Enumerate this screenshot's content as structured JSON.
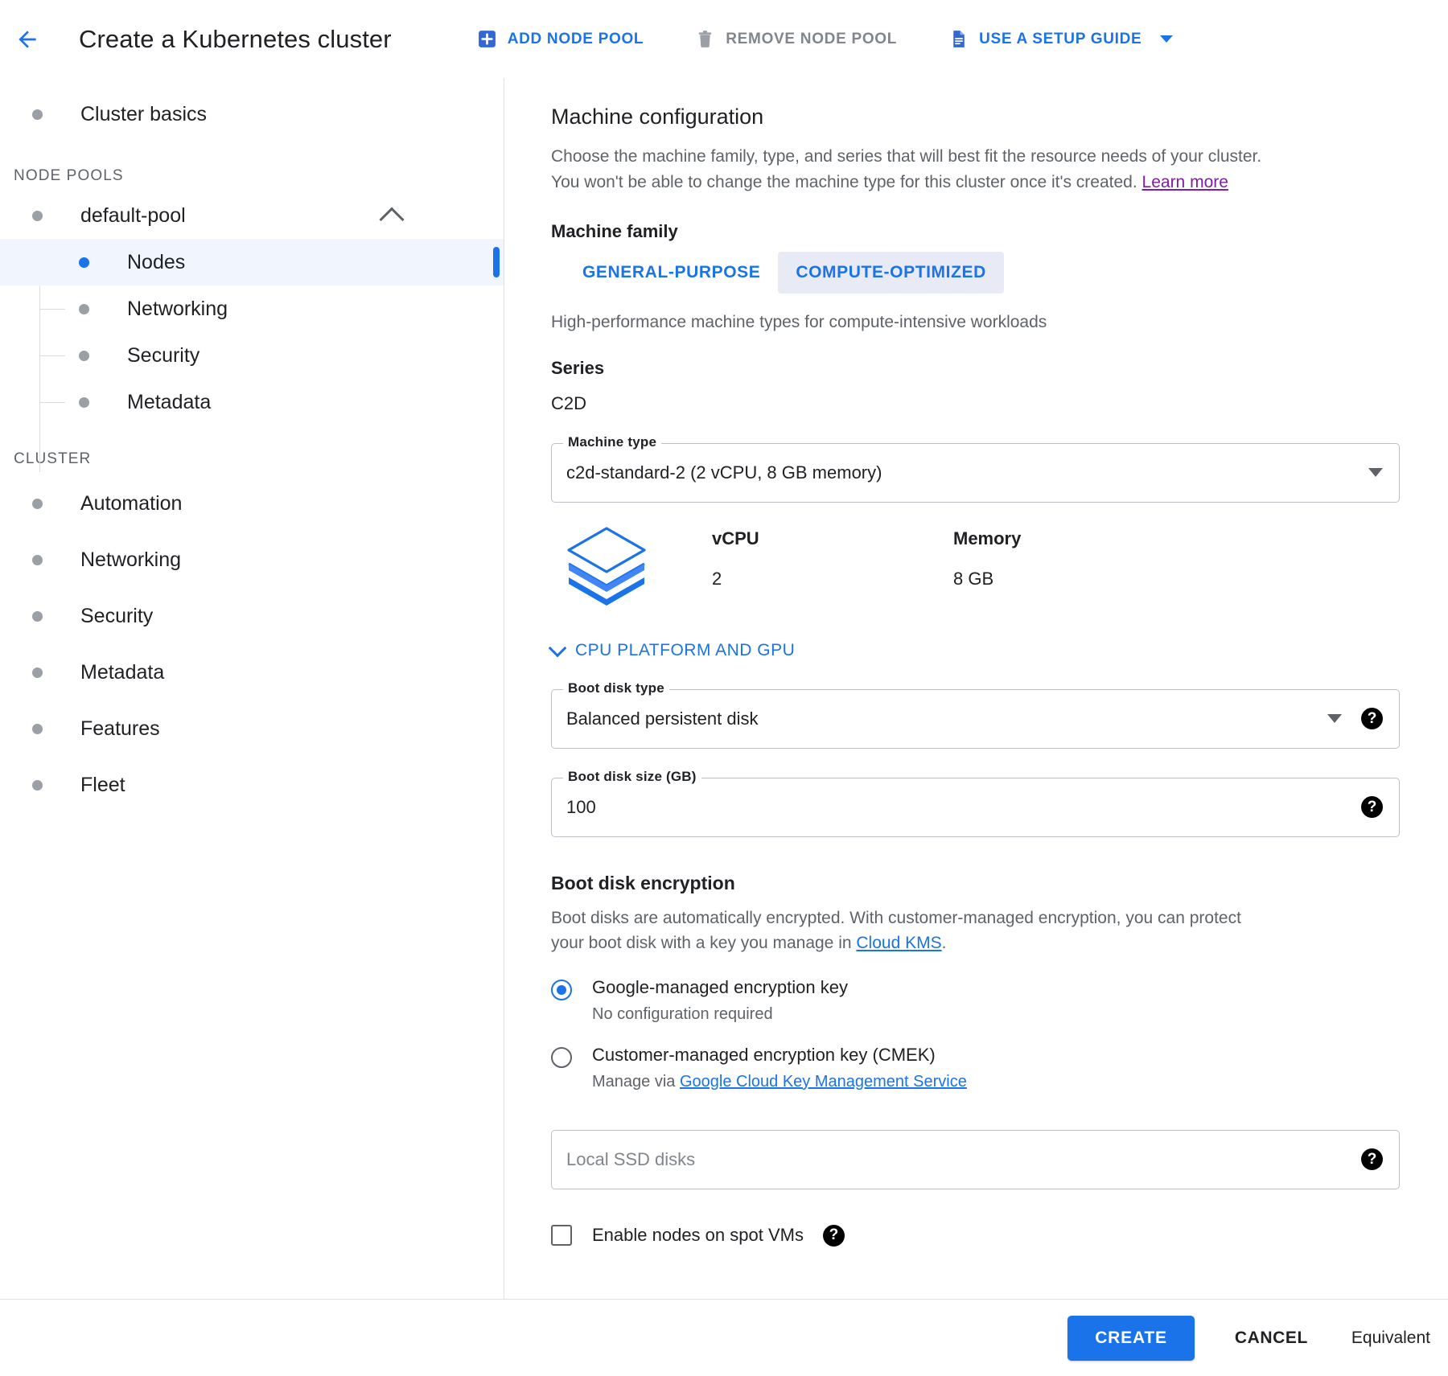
{
  "header": {
    "back_icon": "arrow-back-icon",
    "title": "Create a Kubernetes cluster",
    "actions": [
      {
        "label": "ADD NODE POOL",
        "icon": "add-box-icon",
        "disabled": false
      },
      {
        "label": "REMOVE NODE POOL",
        "icon": "trash-icon",
        "disabled": true
      },
      {
        "label": "USE A SETUP GUIDE",
        "icon": "document-icon",
        "disabled": false,
        "has_caret": true
      }
    ]
  },
  "sidebar": {
    "top_items": [
      {
        "label": "Cluster basics",
        "selected": false
      }
    ],
    "node_pools_heading": "NODE POOLS",
    "pool": {
      "label": "default-pool",
      "selected": false,
      "expand_icon": "chevron-up-icon",
      "expanded": true
    },
    "pool_children": [
      {
        "label": "Nodes",
        "selected": true
      },
      {
        "label": "Networking",
        "selected": false
      },
      {
        "label": "Security",
        "selected": false
      },
      {
        "label": "Metadata",
        "selected": false
      }
    ],
    "cluster_heading": "CLUSTER",
    "cluster_items": [
      {
        "label": "Automation",
        "selected": false
      },
      {
        "label": "Networking",
        "selected": false
      },
      {
        "label": "Security",
        "selected": false
      },
      {
        "label": "Metadata",
        "selected": false
      },
      {
        "label": "Features",
        "selected": false
      },
      {
        "label": "Fleet",
        "selected": false
      }
    ]
  },
  "main": {
    "title": "Machine configuration",
    "description_line1": "Choose the machine family, type, and series that will best fit the resource needs of your cluster.",
    "description_line2": "You won't be able to change the machine type for this cluster once it's created.",
    "learn_more": "Learn more",
    "machine_family_label": "Machine family",
    "family_tabs": [
      {
        "label": "GENERAL-PURPOSE",
        "active": false
      },
      {
        "label": "COMPUTE-OPTIMIZED",
        "active": true
      }
    ],
    "family_helper": "High-performance machine types for compute-intensive workloads",
    "series_label": "Series",
    "series_value": "C2D",
    "machine_type": {
      "legend": "Machine type",
      "value": "c2d-standard-2 (2 vCPU, 8 GB memory)",
      "caret_icon": "chevron-down-icon"
    },
    "machine_stats": {
      "icon": "layers-icon",
      "vcpu_label": "vCPU",
      "vcpu_value": "2",
      "memory_label": "Memory",
      "memory_value": "8 GB"
    },
    "cpu_platform_expander": {
      "label": "CPU PLATFORM AND GPU",
      "icon": "chevron-down-icon"
    },
    "boot_disk_type": {
      "legend": "Boot disk type",
      "value": "Balanced persistent disk",
      "caret_icon": "chevron-down-icon",
      "help_icon": "help-icon"
    },
    "boot_disk_size": {
      "legend": "Boot disk size (GB)",
      "value": "100",
      "help_icon": "help-icon"
    },
    "boot_disk_encryption": {
      "title": "Boot disk encryption",
      "desc_part1": "Boot disks are automatically encrypted. With customer-managed encryption, you can protect your boot disk with a key you manage in",
      "desc_link": "Cloud KMS",
      "desc_suffix": ".",
      "options": [
        {
          "label": "Google-managed encryption key",
          "sublabel": "No configuration required",
          "selected": true
        },
        {
          "label": "Customer-managed encryption key (CMEK)",
          "sublabel_prefix": "Manage via",
          "sublabel_link": "Google Cloud Key Management Service",
          "selected": false
        }
      ]
    },
    "local_ssd": {
      "placeholder": "Local SSD disks",
      "value": "",
      "help_icon": "help-icon"
    },
    "spot_vms": {
      "label": "Enable nodes on spot VMs",
      "checked": false,
      "help_icon": "help-icon"
    }
  },
  "footer": {
    "create_label": "CREATE",
    "cancel_label": "CANCEL",
    "equivalent_label": "Equivalent"
  },
  "colors": {
    "accent_blue": "#1a73e8",
    "selected_row_bg": "#f1f5fe",
    "active_tab_bg": "#e8eaf6",
    "muted_gray": "#5f6368",
    "visited_link_purple": "#7b1fa2"
  }
}
